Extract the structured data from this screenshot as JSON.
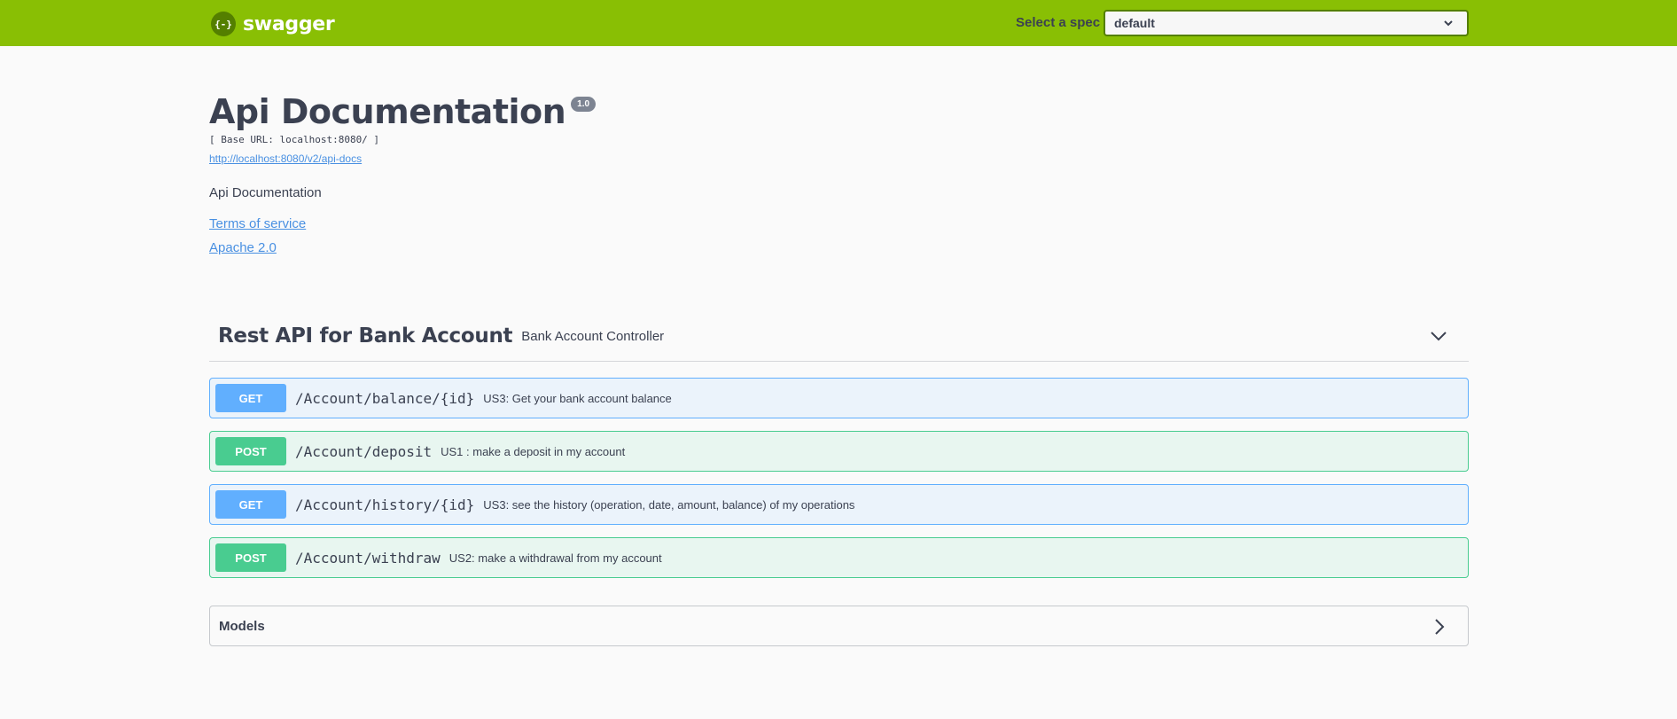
{
  "topbar": {
    "brand_icon_text": "{-}",
    "brand_name": "swagger",
    "spec_label": "Select a spec",
    "spec_selected": "default",
    "brand_color": "#89bf04"
  },
  "info": {
    "title": "Api Documentation",
    "version": "1.0",
    "base_url": "[ Base URL: localhost:8080/ ]",
    "api_docs_link": "http://localhost:8080/v2/api-docs",
    "description": "Api Documentation",
    "terms_of_service": "Terms of service",
    "license": "Apache 2.0"
  },
  "tag": {
    "name": "Rest API for Bank Account",
    "description": "Bank Account Controller",
    "chevron_icon": "chevron-down-icon"
  },
  "operations": [
    {
      "method": "GET",
      "path": "/Account/balance/{id}",
      "summary": "US3: Get your bank account balance"
    },
    {
      "method": "POST",
      "path": "/Account/deposit",
      "summary": "US1 : make a deposit in my account"
    },
    {
      "method": "GET",
      "path": "/Account/history/{id}",
      "summary": "US3: see the history (operation, date, amount, balance) of my operations"
    },
    {
      "method": "POST",
      "path": "/Account/withdraw",
      "summary": "US2: make a withdrawal from my account"
    }
  ],
  "models": {
    "title": "Models",
    "chevron_icon": "chevron-right-icon"
  },
  "colors": {
    "get": "#61affe",
    "post": "#49cc90",
    "link": "#4990e2"
  }
}
